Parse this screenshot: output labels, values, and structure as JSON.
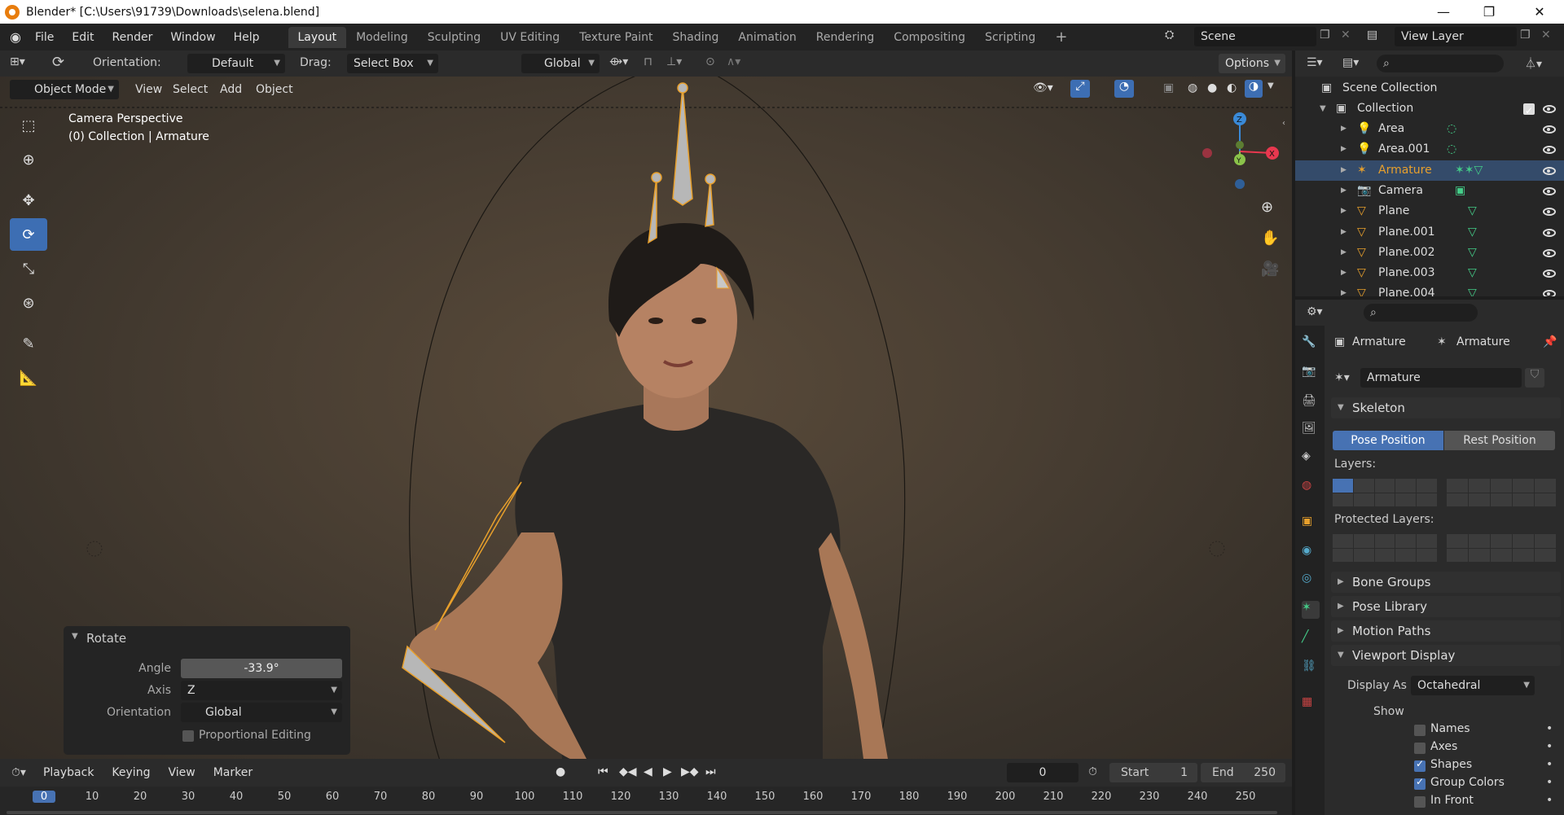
{
  "window": {
    "title": "Blender* [C:\\Users\\91739\\Downloads\\selena.blend]",
    "minimize": "—",
    "restore": "❐",
    "close": "✕"
  },
  "menu": [
    "File",
    "Edit",
    "Render",
    "Window",
    "Help"
  ],
  "workspaces": [
    "Layout",
    "Modeling",
    "Sculpting",
    "UV Editing",
    "Texture Paint",
    "Shading",
    "Animation",
    "Rendering",
    "Compositing",
    "Scripting"
  ],
  "active_workspace": "Layout",
  "add_workspace": "+",
  "scene": {
    "name": "Scene",
    "view_layer": "View Layer"
  },
  "tool_header": {
    "orientation_label": "Orientation:",
    "orientation_value": "Default",
    "drag_label": "Drag:",
    "drag_value": "Select Box",
    "transform_orientation": "Global",
    "options": "Options"
  },
  "viewport_header": {
    "mode": "Object Mode",
    "menus": [
      "View",
      "Select",
      "Add",
      "Object"
    ]
  },
  "viewport": {
    "camera_label": "Camera Perspective",
    "collection_label": "(0) Collection | Armature",
    "gizmo_x": "X",
    "gizmo_y": "Y",
    "gizmo_z": "Z"
  },
  "tools": [
    "select-box-tool",
    "cursor-tool",
    "move-tool",
    "rotate-tool",
    "scale-tool",
    "transform-tool",
    "annotate-tool",
    "measure-tool"
  ],
  "active_tool": "rotate-tool",
  "redo_panel": {
    "title": "Rotate",
    "angle_label": "Angle",
    "angle_value": "-33.9°",
    "axis_label": "Axis",
    "axis_value": "Z",
    "orientation_label": "Orientation",
    "orientation_value": "Global",
    "proportional_label": "Proportional Editing",
    "proportional_checked": false
  },
  "timeline": {
    "menus": [
      "Playback",
      "Keying",
      "View",
      "Marker"
    ],
    "current_frame": "0",
    "start_label": "Start",
    "start_value": "1",
    "end_label": "End",
    "end_value": "250",
    "ticks": [
      "0",
      "10",
      "20",
      "30",
      "40",
      "50",
      "60",
      "70",
      "80",
      "90",
      "100",
      "110",
      "120",
      "130",
      "140",
      "150",
      "160",
      "170",
      "180",
      "190",
      "200",
      "210",
      "220",
      "230",
      "240",
      "250"
    ]
  },
  "outliner": {
    "scene_collection": "Scene Collection",
    "collection": "Collection",
    "items": [
      {
        "name": "Area",
        "type": "light",
        "selected": false
      },
      {
        "name": "Area.001",
        "type": "light",
        "selected": false
      },
      {
        "name": "Armature",
        "type": "armature",
        "selected": true
      },
      {
        "name": "Camera",
        "type": "camera",
        "selected": false
      },
      {
        "name": "Plane",
        "type": "mesh",
        "selected": false
      },
      {
        "name": "Plane.001",
        "type": "mesh",
        "selected": false
      },
      {
        "name": "Plane.002",
        "type": "mesh",
        "selected": false
      },
      {
        "name": "Plane.003",
        "type": "mesh",
        "selected": false
      },
      {
        "name": "Plane.004",
        "type": "mesh",
        "selected": false
      }
    ]
  },
  "properties": {
    "breadcrumb_object": "Armature",
    "breadcrumb_data": "Armature",
    "datablock_name": "Armature",
    "skeleton": {
      "title": "Skeleton",
      "pose_position": "Pose Position",
      "rest_position": "Rest Position",
      "layers_label": "Layers:",
      "protected_layers_label": "Protected Layers:"
    },
    "collapsed_panels": [
      "Bone Groups",
      "Pose Library",
      "Motion Paths"
    ],
    "viewport_display": {
      "title": "Viewport Display",
      "display_as_label": "Display As",
      "display_as_value": "Octahedral",
      "show_label": "Show",
      "options": [
        {
          "label": "Names",
          "checked": false
        },
        {
          "label": "Axes",
          "checked": false
        },
        {
          "label": "Shapes",
          "checked": true
        },
        {
          "label": "Group Colors",
          "checked": true
        },
        {
          "label": "In Front",
          "checked": false
        }
      ]
    }
  },
  "colors": {
    "accent": "#4772b3",
    "selected_orange": "#e8a02c",
    "bone_fill": "#b7b7b7",
    "gizmo_x": "#e8384f",
    "gizmo_y": "#8bc34a",
    "gizmo_z": "#3a8ad8"
  }
}
